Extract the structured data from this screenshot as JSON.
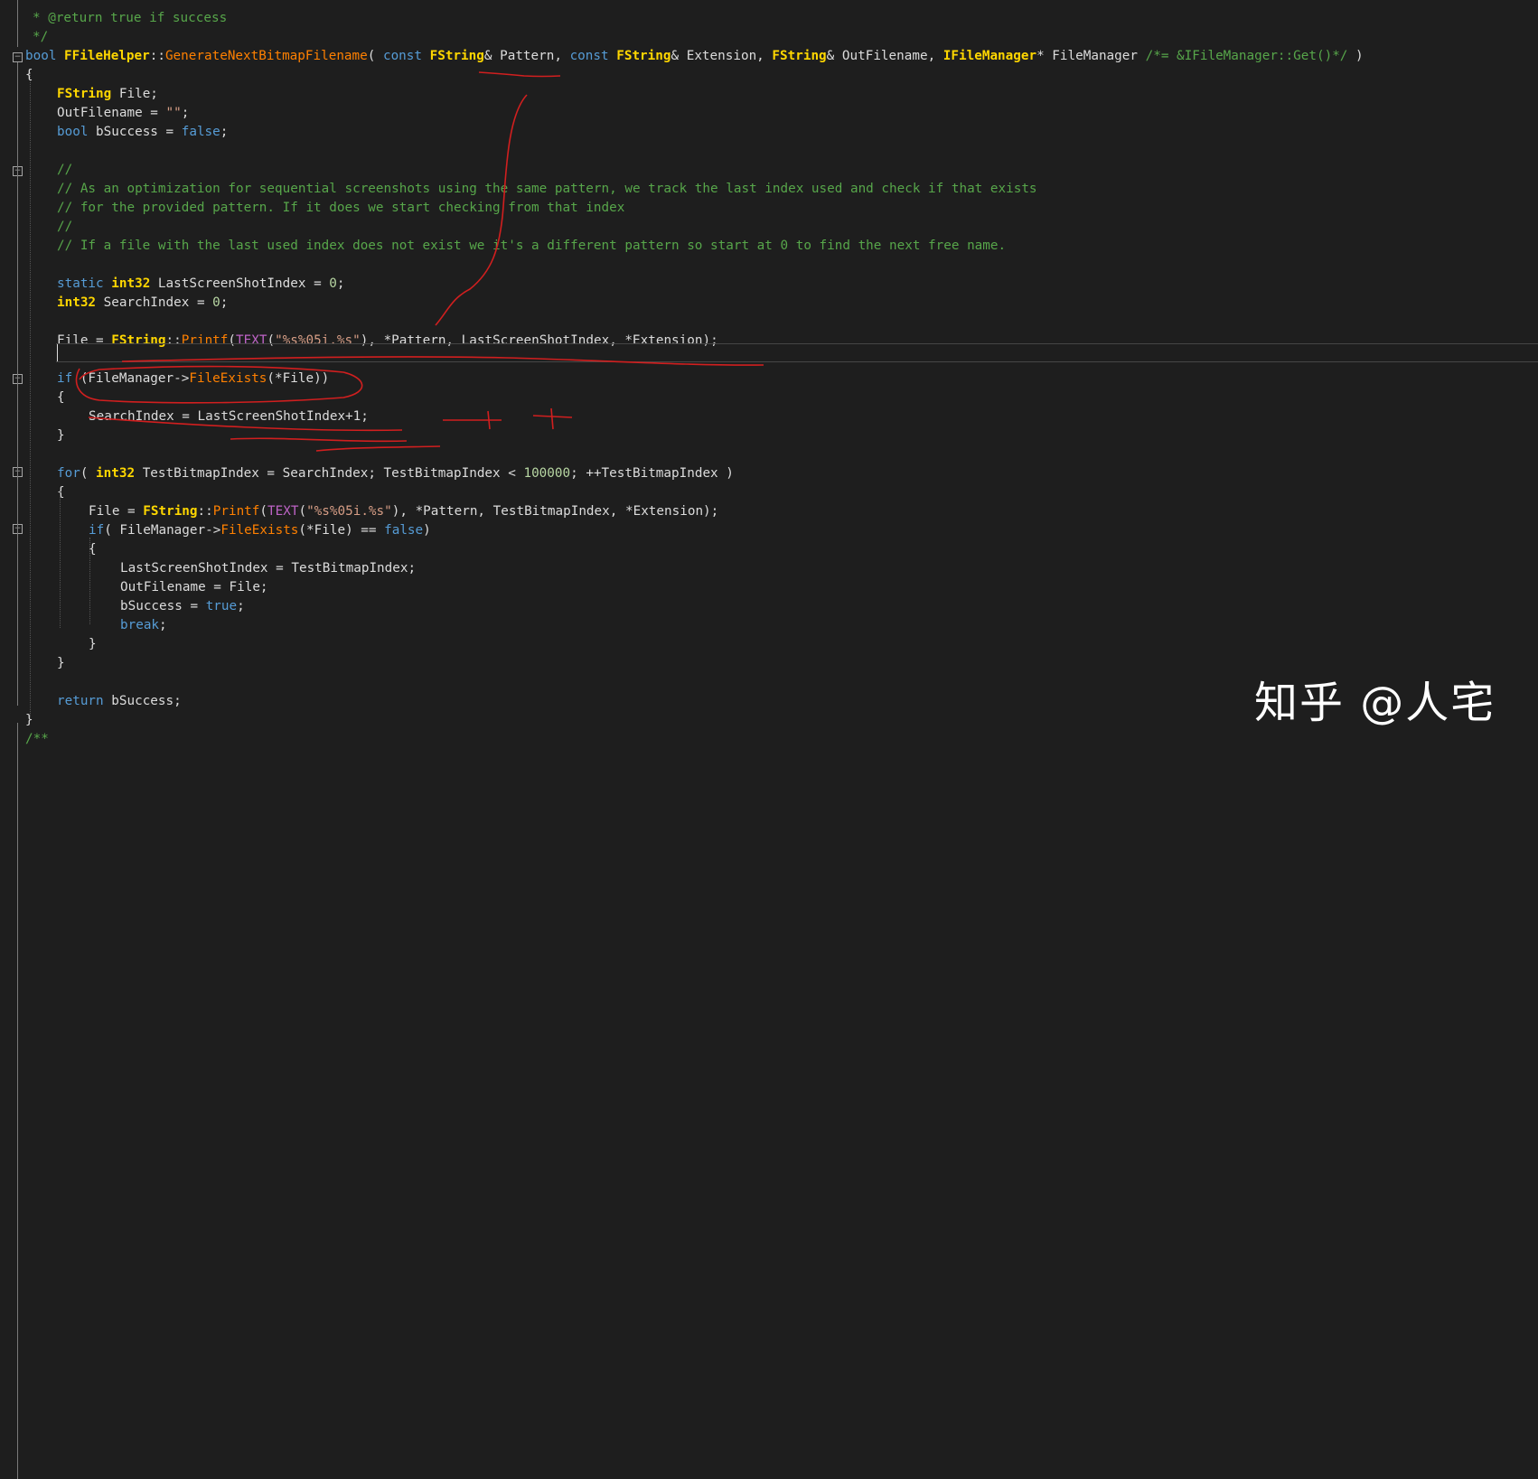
{
  "editor": {
    "watermark": "知乎 @人宅",
    "lines": [
      [
        [
          "c",
          "* @return true if success"
        ]
      ],
      [
        [
          "c",
          "*/"
        ]
      ],
      [
        [
          "k",
          "bool "
        ],
        [
          "t",
          "FFileHelper"
        ],
        [
          "p",
          "::"
        ],
        [
          "f",
          "GenerateNextBitmapFilename"
        ],
        [
          "p",
          "( "
        ],
        [
          "k",
          "const "
        ],
        [
          "t",
          "FString"
        ],
        [
          "p",
          "& Pattern, "
        ],
        [
          "k",
          "const "
        ],
        [
          "t",
          "FString"
        ],
        [
          "p",
          "& Extension, "
        ],
        [
          "t",
          "FString"
        ],
        [
          "p",
          "& OutFilename, "
        ],
        [
          "t",
          "IFileManager"
        ],
        [
          "p",
          "* FileManager "
        ],
        [
          "c",
          "/*= &IFileManager::Get()*/"
        ],
        [
          "p",
          " )"
        ]
      ],
      [
        [
          "p",
          "{"
        ]
      ],
      [
        [
          "t",
          "FString"
        ],
        [
          "id",
          " File;"
        ]
      ],
      [
        [
          "id",
          "OutFilename = "
        ],
        [
          "s",
          "\"\""
        ],
        [
          "p",
          ";"
        ]
      ],
      [
        [
          "k",
          "bool "
        ],
        [
          "id",
          "bSuccess = "
        ],
        [
          "k",
          "false"
        ],
        [
          "p",
          ";"
        ]
      ],
      [],
      [
        [
          "c",
          "//"
        ]
      ],
      [
        [
          "c",
          "// As an optimization for sequential screenshots using the same pattern, we track the last index used and check if that exists"
        ]
      ],
      [
        [
          "c",
          "// for the provided pattern. If it does we start checking from that index"
        ]
      ],
      [
        [
          "c",
          "//"
        ]
      ],
      [
        [
          "c",
          "// If a file with the last used index does not exist we it's a different pattern so start at 0 to find the next free name."
        ]
      ],
      [],
      [
        [
          "k",
          "static "
        ],
        [
          "t",
          "int32 "
        ],
        [
          "id",
          "LastScreenShotIndex = "
        ],
        [
          "m",
          "0"
        ],
        [
          "p",
          ";"
        ]
      ],
      [
        [
          "t",
          "int32 "
        ],
        [
          "id",
          "SearchIndex = "
        ],
        [
          "m",
          "0"
        ],
        [
          "p",
          ";"
        ]
      ],
      [],
      [
        [
          "id",
          "File = "
        ],
        [
          "t",
          "FString"
        ],
        [
          "p",
          "::"
        ],
        [
          "f",
          "Printf"
        ],
        [
          "p",
          "("
        ],
        [
          "mac",
          "TEXT"
        ],
        [
          "p",
          "("
        ],
        [
          "s",
          "\"%s%05i.%s\""
        ],
        [
          "p",
          "), *Pattern, LastScreenShotIndex, *Extension);"
        ]
      ],
      [],
      [
        [
          "k",
          "if "
        ],
        [
          "p",
          "(FileManager->"
        ],
        [
          "f",
          "FileExists"
        ],
        [
          "p",
          "(*File))"
        ]
      ],
      [
        [
          "p",
          "{"
        ]
      ],
      [
        [
          "id",
          "SearchIndex = LastScreenShotIndex+1;"
        ]
      ],
      [
        [
          "p",
          "}"
        ]
      ],
      [],
      [
        [
          "k",
          "for"
        ],
        [
          "p",
          "( "
        ],
        [
          "t",
          "int32 "
        ],
        [
          "id",
          "TestBitmapIndex = SearchIndex; TestBitmapIndex < "
        ],
        [
          "m",
          "100000"
        ],
        [
          "p",
          "; ++TestBitmapIndex )"
        ]
      ],
      [
        [
          "p",
          "{"
        ]
      ],
      [
        [
          "id",
          "File = "
        ],
        [
          "t",
          "FString"
        ],
        [
          "p",
          "::"
        ],
        [
          "f",
          "Printf"
        ],
        [
          "p",
          "("
        ],
        [
          "mac",
          "TEXT"
        ],
        [
          "p",
          "("
        ],
        [
          "s",
          "\"%s%05i.%s\""
        ],
        [
          "p",
          "), *Pattern, TestBitmapIndex, *Extension);"
        ]
      ],
      [
        [
          "k",
          "if"
        ],
        [
          "p",
          "( FileManager->"
        ],
        [
          "f",
          "FileExists"
        ],
        [
          "p",
          "(*File) == "
        ],
        [
          "k",
          "false"
        ],
        [
          "p",
          ")"
        ]
      ],
      [
        [
          "p",
          "{"
        ]
      ],
      [
        [
          "id",
          "LastScreenShotIndex = TestBitmapIndex;"
        ]
      ],
      [
        [
          "id",
          "OutFilename = File;"
        ]
      ],
      [
        [
          "id",
          "bSuccess = "
        ],
        [
          "k",
          "true"
        ],
        [
          "p",
          ";"
        ]
      ],
      [
        [
          "k",
          "break"
        ],
        [
          "p",
          ";"
        ]
      ],
      [
        [
          "p",
          "}"
        ]
      ],
      [
        [
          "p",
          "}"
        ]
      ],
      [],
      [
        [
          "k",
          "return "
        ],
        [
          "id",
          "bSuccess;"
        ]
      ],
      [
        [
          "p",
          "}"
        ]
      ],
      [
        [
          "c",
          "/**"
        ]
      ]
    ]
  }
}
